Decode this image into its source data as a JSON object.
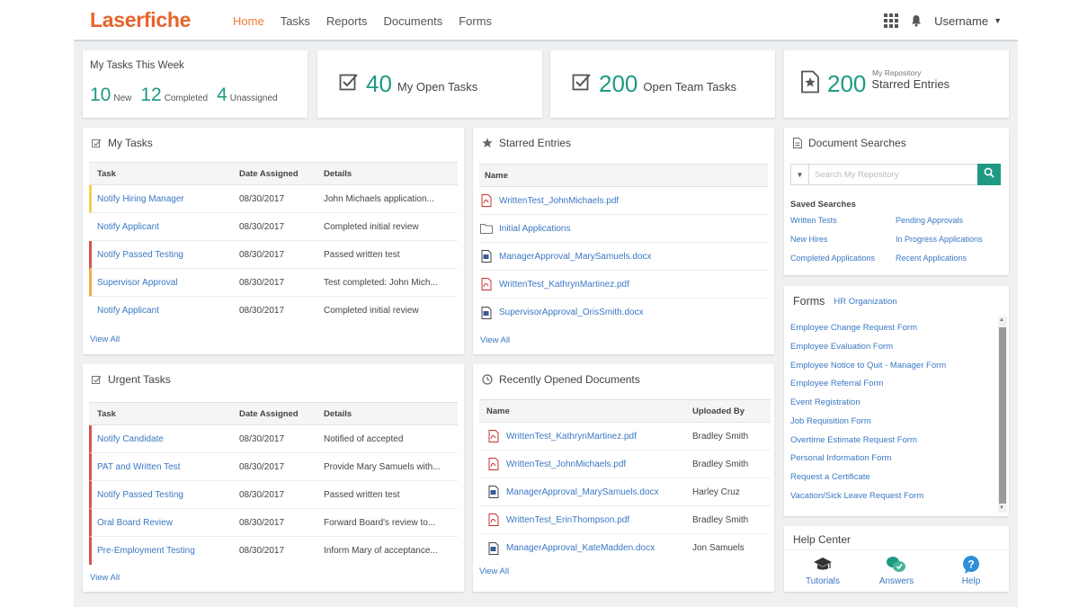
{
  "header": {
    "logo": "Laserfiche",
    "nav": [
      "Home",
      "Tasks",
      "Reports",
      "Documents",
      "Forms"
    ],
    "active_nav": "Home",
    "username": "Username",
    "accent": "#f07a36"
  },
  "stats": {
    "week_title": "My Tasks This Week",
    "new_count": "10",
    "new_label": "New",
    "completed_count": "12",
    "completed_label": "Completed",
    "unassigned_count": "4",
    "unassigned_label": "Unassigned",
    "open_tasks_count": "40",
    "open_tasks_label": "My Open Tasks",
    "team_tasks_count": "200",
    "team_tasks_label": "Open Team Tasks",
    "starred_count": "200",
    "starred_sub": "My Repository",
    "starred_label": "Starred Entries",
    "number_color": "#1e9a83"
  },
  "my_tasks": {
    "title": "My Tasks",
    "columns": [
      "Task",
      "Date Assigned",
      "Details"
    ],
    "rows": [
      {
        "task": "Notify Hiring Manager",
        "date": "08/30/2017",
        "details": "John Michaels application...",
        "flag": "#f2d04b"
      },
      {
        "task": "Notify Applicant",
        "date": "08/30/2017",
        "details": "Completed initial review",
        "flag": ""
      },
      {
        "task": "Notify Passed Testing",
        "date": "08/30/2017",
        "details": "Passed written test",
        "flag": "#d9534f"
      },
      {
        "task": "Supervisor Approval",
        "date": "08/30/2017",
        "details": "Test completed: John Mich...",
        "flag": "#f0ad4e"
      },
      {
        "task": "Notify Applicant",
        "date": "08/30/2017",
        "details": "Completed initial review",
        "flag": ""
      }
    ],
    "view_all": "View All"
  },
  "urgent_tasks": {
    "title": "Urgent Tasks",
    "columns": [
      "Task",
      "Date Assigned",
      "Details"
    ],
    "rows": [
      {
        "task": "Notify Candidate",
        "date": "08/30/2017",
        "details": "Notified of accepted",
        "flag": "#d9534f"
      },
      {
        "task": "PAT and Written Test",
        "date": "08/30/2017",
        "details": "Provide Mary Samuels with...",
        "flag": "#d9534f"
      },
      {
        "task": "Notify Passed Testing",
        "date": "08/30/2017",
        "details": "Passed written test",
        "flag": "#d9534f"
      },
      {
        "task": "Oral Board Review",
        "date": "08/30/2017",
        "details": "Forward Board's review to...",
        "flag": "#d9534f"
      },
      {
        "task": "Pre-Employment Testing",
        "date": "08/30/2017",
        "details": "Inform Mary of acceptance...",
        "flag": "#d9534f"
      }
    ],
    "view_all": "View All"
  },
  "starred": {
    "title": "Starred Entries",
    "column": "Name",
    "rows": [
      {
        "name": "WrittenTest_JohnMichaels.pdf",
        "icon": "pdf-icon"
      },
      {
        "name": "Initial Applications",
        "icon": "folder-icon"
      },
      {
        "name": "ManagerApproval_MarySamuels.docx",
        "icon": "doc-icon"
      },
      {
        "name": "WrittenTest_KathrynMartinez.pdf",
        "icon": "pdf-icon"
      },
      {
        "name": "SupervisorApproval_OrisSmith.docx",
        "icon": "doc-icon"
      }
    ],
    "view_all": "View All"
  },
  "recent": {
    "title": "Recently Opened Documents",
    "columns": [
      "Name",
      "Uploaded By"
    ],
    "rows": [
      {
        "name": "WrittenTest_KathrynMartinez.pdf",
        "by": "Bradley Smith",
        "icon": "pdf-icon"
      },
      {
        "name": "WrittenTest_JohnMichaels.pdf",
        "by": "Bradley Smith",
        "icon": "pdf-icon"
      },
      {
        "name": "ManagerApproval_MarySamuels.docx",
        "by": "Harley Cruz",
        "icon": "doc-icon"
      },
      {
        "name": "WrittenTest_ErinThompson.pdf",
        "by": "Bradley Smith",
        "icon": "pdf-icon"
      },
      {
        "name": "ManagerApproval_KateMadden.docx",
        "by": "Jon Samuels",
        "icon": "doc-icon"
      }
    ],
    "view_all": "View All"
  },
  "doc_search": {
    "title": "Document Searches",
    "placeholder": "Search My Repository",
    "saved_title": "Saved Searches",
    "saved": [
      "Written Tests",
      "Pending Approvals",
      "New Hires",
      "In Progress Applications",
      "Completed Applications",
      "Recent Applications"
    ]
  },
  "forms": {
    "title": "Forms",
    "subtitle": "HR Organization",
    "items": [
      "Employee Change Request Form",
      "Employee Evaluation Form",
      "Employee Notice to Quit - Manager Form",
      "Employee Referral Form",
      "Event Registration",
      "Job Requisition Form",
      "Overtime Estimate Request Form",
      "Personal Information Form",
      "Request a Certificate",
      "Vacation/Sick Leave Request Form"
    ]
  },
  "help": {
    "title": "Help Center",
    "items": [
      "Tutorials",
      "Answers",
      "Help"
    ]
  }
}
